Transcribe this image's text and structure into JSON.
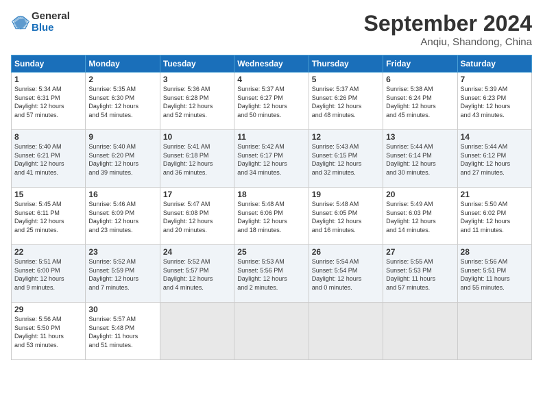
{
  "header": {
    "logo_general": "General",
    "logo_blue": "Blue",
    "month_title": "September 2024",
    "subtitle": "Anqiu, Shandong, China"
  },
  "days_of_week": [
    "Sunday",
    "Monday",
    "Tuesday",
    "Wednesday",
    "Thursday",
    "Friday",
    "Saturday"
  ],
  "weeks": [
    [
      {
        "day": "1",
        "info": "Sunrise: 5:34 AM\nSunset: 6:31 PM\nDaylight: 12 hours\nand 57 minutes."
      },
      {
        "day": "2",
        "info": "Sunrise: 5:35 AM\nSunset: 6:30 PM\nDaylight: 12 hours\nand 54 minutes."
      },
      {
        "day": "3",
        "info": "Sunrise: 5:36 AM\nSunset: 6:28 PM\nDaylight: 12 hours\nand 52 minutes."
      },
      {
        "day": "4",
        "info": "Sunrise: 5:37 AM\nSunset: 6:27 PM\nDaylight: 12 hours\nand 50 minutes."
      },
      {
        "day": "5",
        "info": "Sunrise: 5:37 AM\nSunset: 6:26 PM\nDaylight: 12 hours\nand 48 minutes."
      },
      {
        "day": "6",
        "info": "Sunrise: 5:38 AM\nSunset: 6:24 PM\nDaylight: 12 hours\nand 45 minutes."
      },
      {
        "day": "7",
        "info": "Sunrise: 5:39 AM\nSunset: 6:23 PM\nDaylight: 12 hours\nand 43 minutes."
      }
    ],
    [
      {
        "day": "8",
        "info": "Sunrise: 5:40 AM\nSunset: 6:21 PM\nDaylight: 12 hours\nand 41 minutes."
      },
      {
        "day": "9",
        "info": "Sunrise: 5:40 AM\nSunset: 6:20 PM\nDaylight: 12 hours\nand 39 minutes."
      },
      {
        "day": "10",
        "info": "Sunrise: 5:41 AM\nSunset: 6:18 PM\nDaylight: 12 hours\nand 36 minutes."
      },
      {
        "day": "11",
        "info": "Sunrise: 5:42 AM\nSunset: 6:17 PM\nDaylight: 12 hours\nand 34 minutes."
      },
      {
        "day": "12",
        "info": "Sunrise: 5:43 AM\nSunset: 6:15 PM\nDaylight: 12 hours\nand 32 minutes."
      },
      {
        "day": "13",
        "info": "Sunrise: 5:44 AM\nSunset: 6:14 PM\nDaylight: 12 hours\nand 30 minutes."
      },
      {
        "day": "14",
        "info": "Sunrise: 5:44 AM\nSunset: 6:12 PM\nDaylight: 12 hours\nand 27 minutes."
      }
    ],
    [
      {
        "day": "15",
        "info": "Sunrise: 5:45 AM\nSunset: 6:11 PM\nDaylight: 12 hours\nand 25 minutes."
      },
      {
        "day": "16",
        "info": "Sunrise: 5:46 AM\nSunset: 6:09 PM\nDaylight: 12 hours\nand 23 minutes."
      },
      {
        "day": "17",
        "info": "Sunrise: 5:47 AM\nSunset: 6:08 PM\nDaylight: 12 hours\nand 20 minutes."
      },
      {
        "day": "18",
        "info": "Sunrise: 5:48 AM\nSunset: 6:06 PM\nDaylight: 12 hours\nand 18 minutes."
      },
      {
        "day": "19",
        "info": "Sunrise: 5:48 AM\nSunset: 6:05 PM\nDaylight: 12 hours\nand 16 minutes."
      },
      {
        "day": "20",
        "info": "Sunrise: 5:49 AM\nSunset: 6:03 PM\nDaylight: 12 hours\nand 14 minutes."
      },
      {
        "day": "21",
        "info": "Sunrise: 5:50 AM\nSunset: 6:02 PM\nDaylight: 12 hours\nand 11 minutes."
      }
    ],
    [
      {
        "day": "22",
        "info": "Sunrise: 5:51 AM\nSunset: 6:00 PM\nDaylight: 12 hours\nand 9 minutes."
      },
      {
        "day": "23",
        "info": "Sunrise: 5:52 AM\nSunset: 5:59 PM\nDaylight: 12 hours\nand 7 minutes."
      },
      {
        "day": "24",
        "info": "Sunrise: 5:52 AM\nSunset: 5:57 PM\nDaylight: 12 hours\nand 4 minutes."
      },
      {
        "day": "25",
        "info": "Sunrise: 5:53 AM\nSunset: 5:56 PM\nDaylight: 12 hours\nand 2 minutes."
      },
      {
        "day": "26",
        "info": "Sunrise: 5:54 AM\nSunset: 5:54 PM\nDaylight: 12 hours\nand 0 minutes."
      },
      {
        "day": "27",
        "info": "Sunrise: 5:55 AM\nSunset: 5:53 PM\nDaylight: 11 hours\nand 57 minutes."
      },
      {
        "day": "28",
        "info": "Sunrise: 5:56 AM\nSunset: 5:51 PM\nDaylight: 11 hours\nand 55 minutes."
      }
    ],
    [
      {
        "day": "29",
        "info": "Sunrise: 5:56 AM\nSunset: 5:50 PM\nDaylight: 11 hours\nand 53 minutes."
      },
      {
        "day": "30",
        "info": "Sunrise: 5:57 AM\nSunset: 5:48 PM\nDaylight: 11 hours\nand 51 minutes."
      },
      {
        "day": "",
        "info": ""
      },
      {
        "day": "",
        "info": ""
      },
      {
        "day": "",
        "info": ""
      },
      {
        "day": "",
        "info": ""
      },
      {
        "day": "",
        "info": ""
      }
    ]
  ]
}
